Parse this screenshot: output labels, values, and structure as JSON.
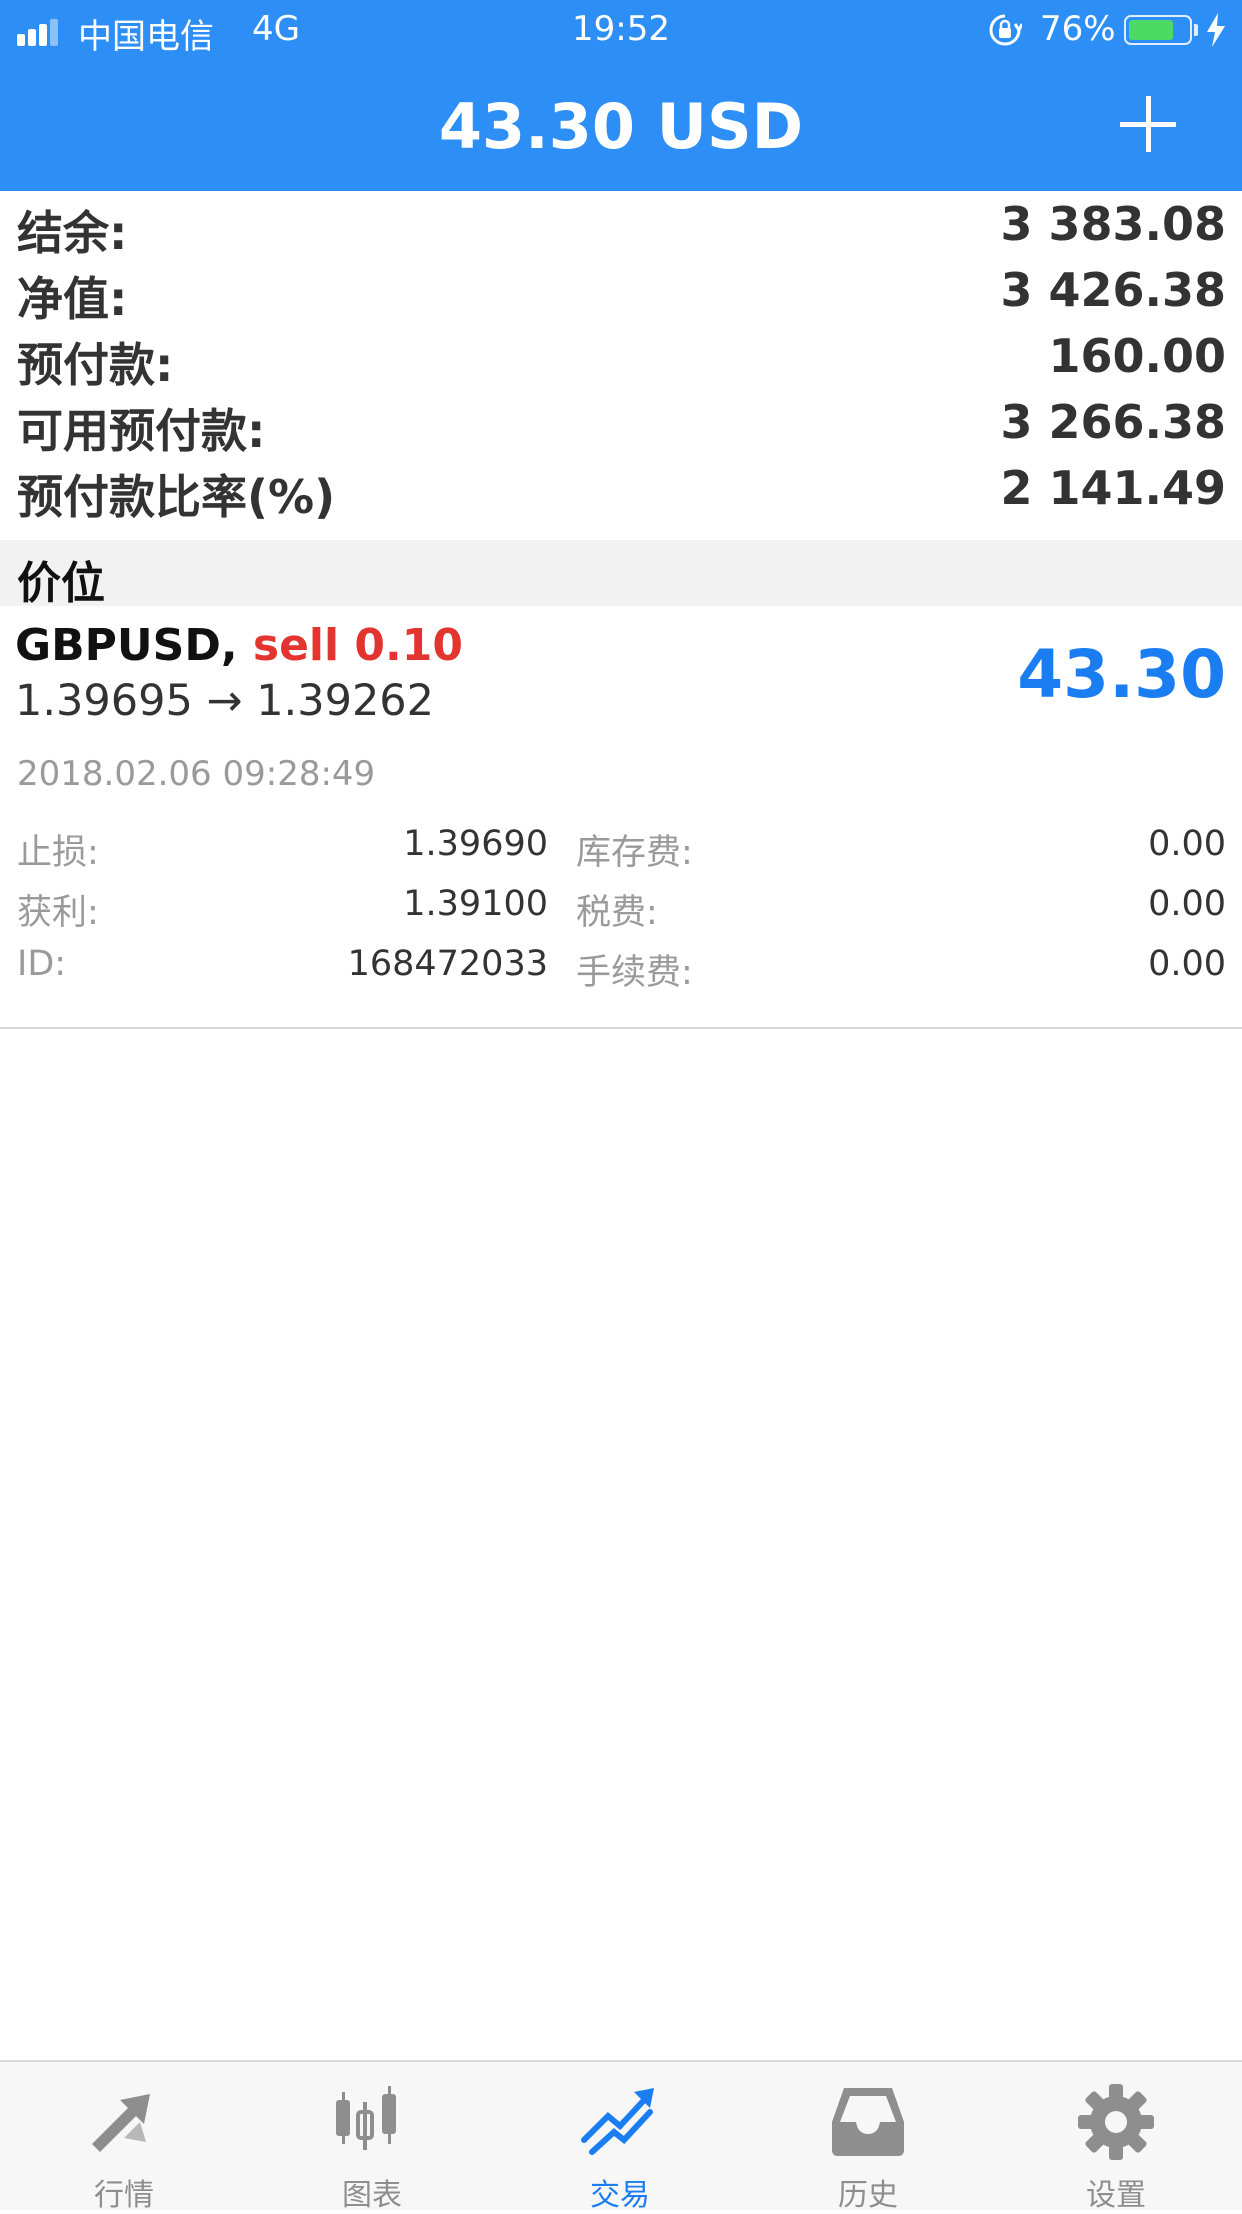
{
  "status_bar": {
    "carrier": "中国电信",
    "network": "4G",
    "time": "19:52",
    "battery": "76%",
    "battery_level": 0.76
  },
  "header": {
    "title": "43.30 USD",
    "add_icon": "plus-icon"
  },
  "summary": [
    {
      "label": "结余:",
      "value": "3 383.08"
    },
    {
      "label": "净值:",
      "value": "3 426.38"
    },
    {
      "label": "预付款:",
      "value": "160.00"
    },
    {
      "label": "可用预付款:",
      "value": "3 266.38"
    },
    {
      "label": "预付款比率(%)",
      "value": "2 141.49"
    }
  ],
  "section_title": "价位",
  "position": {
    "symbol": "GBPUSD,",
    "side": "sell 0.10",
    "open_price": "1.39695",
    "arrow": "→",
    "current_price": "1.39262",
    "profit": "43.30",
    "time": "2018.02.06 09:28:49",
    "details_left": [
      {
        "label": "止损:",
        "value": "1.39690"
      },
      {
        "label": "获利:",
        "value": "1.39100"
      },
      {
        "label": "ID:",
        "value": "168472033"
      }
    ],
    "details_right": [
      {
        "label": "库存费:",
        "value": "0.00"
      },
      {
        "label": "税费:",
        "value": "0.00"
      },
      {
        "label": "手续费:",
        "value": "0.00"
      }
    ]
  },
  "tabs": [
    {
      "label": "行情",
      "icon": "quotes-arrows-icon"
    },
    {
      "label": "图表",
      "icon": "candlestick-chart-icon"
    },
    {
      "label": "交易",
      "icon": "trade-trend-icon",
      "active": true
    },
    {
      "label": "历史",
      "icon": "inbox-tray-icon"
    },
    {
      "label": "设置",
      "icon": "gear-icon"
    }
  ],
  "colors": {
    "header": "#2d8ef5",
    "sell": "#e3342f",
    "profit": "#1a7ef2",
    "active_tab": "#1a7ef2",
    "inactive_tab": "#8e8e8e"
  }
}
